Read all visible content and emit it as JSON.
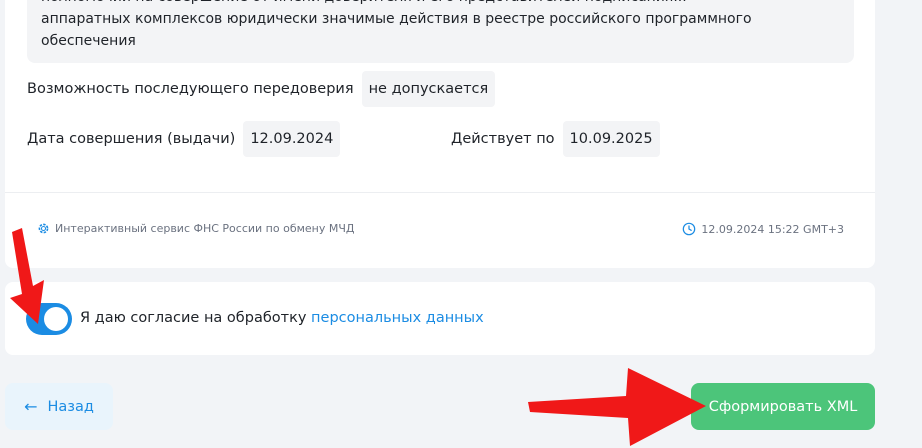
{
  "description": {
    "line_cut": "полномочий на совершение от имени доверителя и его представителей подписания...",
    "line1": "аппаратных комплексов юридически значимые действия в реестре российского программного",
    "line2": "обеспечения"
  },
  "redelegation": {
    "label": "Возможность последующего передоверия",
    "value": "не допускается"
  },
  "issue_date": {
    "label": "Дата совершения (выдачи)",
    "value": "12.09.2024"
  },
  "valid_until": {
    "label": "Действует по",
    "value": "10.09.2025"
  },
  "footer": {
    "service": "Интерактивный сервис ФНС России по обмену МЧД",
    "timestamp": "12.09.2024 15:22 GMT+3",
    "service_icon": "gear-icon",
    "time_icon": "clock-icon"
  },
  "consent": {
    "text": "Я даю согласие на обработку",
    "link": "персональных данных",
    "enabled": true,
    "toggle_color": "#1b8ce3"
  },
  "buttons": {
    "back": "Назад",
    "generate": "Сформировать XML",
    "generate_color": "#4cc57a"
  },
  "annotation_color": "#f01818"
}
